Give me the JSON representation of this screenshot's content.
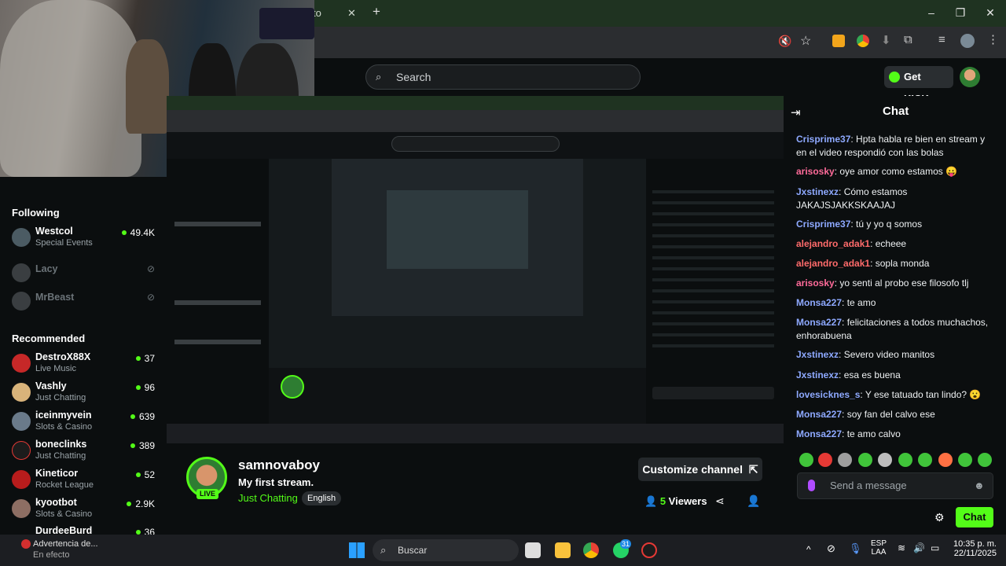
{
  "browser": {
    "tab_title": "to",
    "new_tab": "+",
    "window_controls": [
      "–",
      "❐",
      "✕"
    ]
  },
  "header": {
    "search_placeholder": "Search",
    "get_kicks_label": "Get KICKs"
  },
  "sidebar": {
    "following_title": "Following",
    "following": [
      {
        "name": "Westcol",
        "category": "Special Events",
        "viewers": "49.4K",
        "live": true
      },
      {
        "name": "Lacy",
        "category": "",
        "viewers": "",
        "live": false
      },
      {
        "name": "MrBeast",
        "category": "",
        "viewers": "",
        "live": false
      }
    ],
    "recommended_title": "Recommended",
    "recommended": [
      {
        "name": "DestroX88X",
        "category": "Live Music",
        "viewers": "37"
      },
      {
        "name": "Vashly",
        "category": "Just Chatting",
        "viewers": "96"
      },
      {
        "name": "iceinmyvein",
        "category": "Slots & Casino",
        "viewers": "639"
      },
      {
        "name": "boneclinks",
        "category": "Just Chatting",
        "viewers": "389"
      },
      {
        "name": "Kineticor",
        "category": "Rocket League",
        "viewers": "52"
      },
      {
        "name": "kyootbot",
        "category": "Slots & Casino",
        "viewers": "2.9K"
      },
      {
        "name": "DurdeeBurd",
        "category": "",
        "viewers": "36"
      }
    ]
  },
  "stream": {
    "username": "samnovaboy",
    "title": "My first stream.",
    "category": "Just Chatting",
    "language": "English",
    "live_badge": "LIVE",
    "customize_label": "Customize channel",
    "viewers_count": "5",
    "viewers_label": "Viewers"
  },
  "chat": {
    "title": "Chat",
    "messages": [
      {
        "user": "Crisprime37",
        "color": "#8ea9ff",
        "text": "Hpta habla re bien en stream y en el video respondió con las bolas"
      },
      {
        "user": "arisosky",
        "color": "#ff6b9a",
        "text": "oye amor como estamos 😛"
      },
      {
        "user": "Jxstinexz",
        "color": "#8ea9ff",
        "text": "Cómo estamos JAKAJSJAKKSKAAJAJ"
      },
      {
        "user": "Crisprime37",
        "color": "#8ea9ff",
        "text": "tú y yo q somos"
      },
      {
        "user": "alejandro_adak1",
        "color": "#ff6b6b",
        "text": "echeee"
      },
      {
        "user": "alejandro_adak1",
        "color": "#ff6b6b",
        "text": "sopla monda"
      },
      {
        "user": "arisosky",
        "color": "#ff6b9a",
        "text": "yo senti al probo ese filosofo tlj"
      },
      {
        "user": "Monsa227",
        "color": "#8ea9ff",
        "text": "te amo"
      },
      {
        "user": "Monsa227",
        "color": "#8ea9ff",
        "text": "felicitaciones a todos muchachos, enhorabuena"
      },
      {
        "user": "Jxstinexz",
        "color": "#8ea9ff",
        "text": "Severo video manitos"
      },
      {
        "user": "Jxstinexz",
        "color": "#8ea9ff",
        "text": "esa es buena"
      },
      {
        "user": "lovesicknes_s",
        "color": "#8ea9ff",
        "text": "Y ese tatuado tan lindo? 😮"
      },
      {
        "user": "Monsa227",
        "color": "#8ea9ff",
        "text": "soy fan del calvo ese"
      },
      {
        "user": "Monsa227",
        "color": "#8ea9ff",
        "text": "te amo calvo"
      }
    ],
    "input_placeholder": "Send a message",
    "send_label": "Chat"
  },
  "taskbar": {
    "notification_title": "Advertencia de...",
    "notification_sub": "En efecto",
    "search_placeholder": "Buscar",
    "language": "ESP",
    "language_sub": "LAA",
    "time": "10:35 p. m.",
    "date": "22/11/2025",
    "whatsapp_badge": "31"
  },
  "colors": {
    "accent": "#53fc18",
    "background": "#0b0e0f",
    "browser_titlebar": "#1f3321"
  }
}
